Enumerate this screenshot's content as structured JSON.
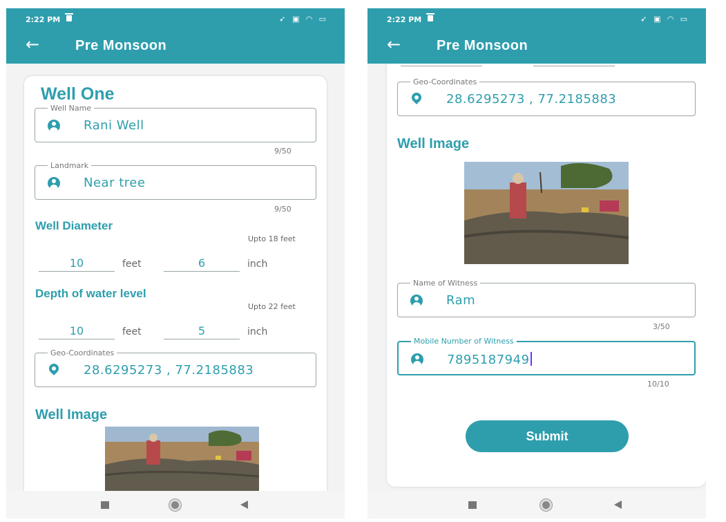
{
  "colors": {
    "accent": "#2e9ead",
    "cursor": "#7a2cff"
  },
  "left": {
    "status": {
      "time": "2:22 PM"
    },
    "appbar": {
      "title": "Pre Monsoon",
      "back_icon": "arrow-left-icon"
    },
    "card_title": "Well One",
    "well_name": {
      "label": "Well Name",
      "value": "Rani Well",
      "counter": "9/50"
    },
    "landmark": {
      "label": "Landmark",
      "value": "Near tree",
      "counter": "9/50"
    },
    "diameter": {
      "heading": "Well Diameter",
      "hint": "Upto 18 feet",
      "feet": "10",
      "feet_unit": "feet",
      "inch": "6",
      "inch_unit": "inch"
    },
    "depth": {
      "heading": "Depth of water level",
      "hint": "Upto 22 feet",
      "feet": "10",
      "feet_unit": "feet",
      "inch": "5",
      "inch_unit": "inch"
    },
    "geo": {
      "label": "Geo-Coordinates",
      "value": "28.6295273 , 77.2185883"
    },
    "image_heading": "Well Image"
  },
  "right": {
    "status": {
      "time": "2:22 PM"
    },
    "appbar": {
      "title": "Pre Monsoon",
      "back_icon": "arrow-left-icon"
    },
    "geo": {
      "label": "Geo-Coordinates",
      "value": "28.6295273 , 77.2185883"
    },
    "image_heading": "Well Image",
    "witness": {
      "label": "Name of Witness",
      "value": "Ram",
      "counter": "3/50"
    },
    "mobile": {
      "label": "Mobile Number of Witness",
      "value": "7895187949",
      "counter": "10/10"
    },
    "submit_label": "Submit"
  }
}
